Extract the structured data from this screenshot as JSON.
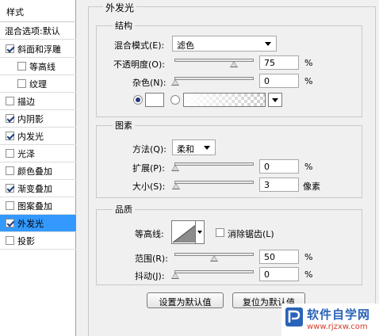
{
  "styles_panel": {
    "header": "样式",
    "blend_options": "混合选项:默认",
    "items": [
      {
        "label": "斜面和浮雕",
        "checked": true,
        "level": 0
      },
      {
        "label": "等高线",
        "checked": false,
        "level": 1
      },
      {
        "label": "纹理",
        "checked": false,
        "level": 1
      },
      {
        "label": "描边",
        "checked": false,
        "level": 0
      },
      {
        "label": "内阴影",
        "checked": true,
        "level": 0
      },
      {
        "label": "内发光",
        "checked": true,
        "level": 0
      },
      {
        "label": "光泽",
        "checked": false,
        "level": 0
      },
      {
        "label": "颜色叠加",
        "checked": false,
        "level": 0
      },
      {
        "label": "渐变叠加",
        "checked": true,
        "level": 0
      },
      {
        "label": "图案叠加",
        "checked": false,
        "level": 0
      },
      {
        "label": "外发光",
        "checked": true,
        "level": 0,
        "selected": true
      },
      {
        "label": "投影",
        "checked": false,
        "level": 0
      }
    ]
  },
  "panel_title": "外发光",
  "structure": {
    "title": "结构",
    "blend_mode_label": "混合模式(E):",
    "blend_mode_value": "滤色",
    "opacity_label": "不透明度(O):",
    "opacity_value": "75",
    "opacity_unit": "%",
    "opacity_level": 0.75,
    "noise_label": "杂色(N):",
    "noise_value": "0",
    "noise_unit": "%",
    "noise_level": 0,
    "color_mode": "solid",
    "glow_color": "#ffffff"
  },
  "elements": {
    "title": "图素",
    "technique_label": "方法(Q):",
    "technique_value": "柔和",
    "spread_label": "扩展(P):",
    "spread_value": "0",
    "spread_unit": "%",
    "spread_level": 0,
    "size_label": "大小(S):",
    "size_value": "3",
    "size_unit": "像素",
    "size_level": 0.012
  },
  "quality": {
    "title": "品质",
    "contour_label": "等高线:",
    "antialias_label": "消除锯齿(L)",
    "antialias_checked": false,
    "range_label": "范围(R):",
    "range_value": "50",
    "range_unit": "%",
    "range_level": 0.5,
    "jitter_label": "抖动(J):",
    "jitter_value": "0",
    "jitter_unit": "%",
    "jitter_level": 0
  },
  "buttons": {
    "make_default": "设置为默认值",
    "reset_default": "复位为默认值"
  },
  "watermark": {
    "title": "软件自学网",
    "url": "www.rjzxw.com",
    "logo_color": "#2a63b8"
  }
}
